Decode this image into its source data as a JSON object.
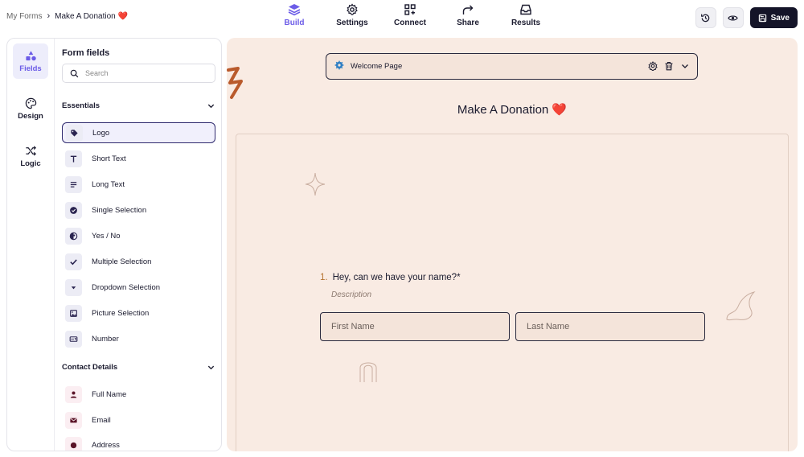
{
  "breadcrumb": {
    "root": "My Forms",
    "separator": "›",
    "current": "Make A Donation ❤️"
  },
  "nav": [
    {
      "label": "Build",
      "icon": "layers-icon",
      "active": true
    },
    {
      "label": "Settings",
      "icon": "gear-icon",
      "active": false
    },
    {
      "label": "Connect",
      "icon": "connect-grid-icon",
      "active": false
    },
    {
      "label": "Share",
      "icon": "share-arrow-icon",
      "active": false
    },
    {
      "label": "Results",
      "icon": "inbox-icon",
      "active": false
    }
  ],
  "toolbar": {
    "history_icon": "history-icon",
    "preview_icon": "eye-icon",
    "save_label": "Save"
  },
  "rail": [
    {
      "label": "Fields",
      "icon": "shapes-icon",
      "active": true
    },
    {
      "label": "Design",
      "icon": "palette-icon",
      "active": false
    },
    {
      "label": "Logic",
      "icon": "shuffle-icon",
      "active": false
    }
  ],
  "fields_panel": {
    "title": "Form fields",
    "search_placeholder": "Search",
    "sections": [
      {
        "title": "Essentials",
        "items": [
          {
            "label": "Logo",
            "icon": "tag-icon",
            "selected": true
          },
          {
            "label": "Short Text",
            "icon": "text-t-icon"
          },
          {
            "label": "Long Text",
            "icon": "paragraph-icon"
          },
          {
            "label": "Single Selection",
            "icon": "check-circle-icon"
          },
          {
            "label": "Yes / No",
            "icon": "yes-no-icon"
          },
          {
            "label": "Multiple Selection",
            "icon": "checkmark-icon"
          },
          {
            "label": "Dropdown Selection",
            "icon": "dropdown-icon"
          },
          {
            "label": "Picture Selection",
            "icon": "picture-icon"
          },
          {
            "label": "Number",
            "icon": "number-icon"
          }
        ]
      },
      {
        "title": "Contact Details",
        "items": [
          {
            "label": "Full Name",
            "icon": "person-icon"
          },
          {
            "label": "Email",
            "icon": "envelope-icon"
          },
          {
            "label": "Address",
            "icon": "location-icon"
          }
        ]
      }
    ]
  },
  "canvas": {
    "page_selector": "Welcome Page",
    "form_title": "Make A Donation ❤️",
    "question": {
      "number": "1.",
      "text": "Hey, can we have your name?*",
      "description": "Description"
    },
    "inputs": {
      "first_placeholder": "First Name",
      "last_placeholder": "Last Name"
    }
  },
  "colors": {
    "accent": "#6c5ce7",
    "dark": "#141428",
    "canvas_bg": "#f9ebe3",
    "question_number": "#b4722e"
  }
}
